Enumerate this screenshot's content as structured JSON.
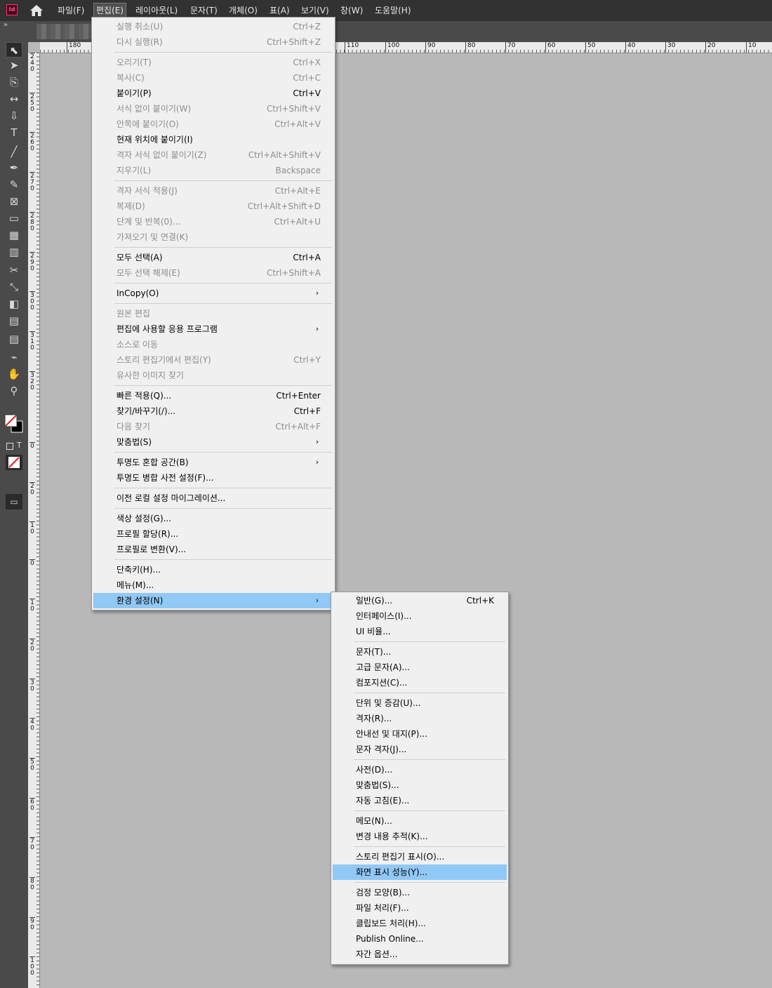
{
  "app": {
    "logo_text": "Id"
  },
  "menubar": {
    "items": [
      "파일(F)",
      "편집(E)",
      "레이아웃(L)",
      "문자(T)",
      "개체(O)",
      "표(A)",
      "보기(V)",
      "창(W)",
      "도움말(H)"
    ],
    "active": "편집(E)"
  },
  "ruler": {
    "h_labels": [
      "180",
      "110",
      "100",
      "90",
      "80",
      "70",
      "60",
      "50",
      "40",
      "30",
      "20",
      "10"
    ],
    "v_labels": [
      "240",
      "250",
      "260",
      "270",
      "280",
      "290",
      "300",
      "310",
      "320",
      "0",
      "20",
      "10",
      "0",
      "10",
      "20",
      "30",
      "40",
      "50",
      "60",
      "70",
      "80",
      "90",
      "100"
    ]
  },
  "toolbar": {
    "tools": [
      "selection-tool",
      "direct-selection-tool",
      "page-tool",
      "gap-tool",
      "content-collector-tool",
      "type-tool",
      "line-tool",
      "pen-tool",
      "pencil-tool",
      "rectangle-frame-tool",
      "rectangle-tool",
      "table-tool",
      "grid-tool",
      "scissors-tool",
      "free-transform-tool",
      "gradient-swatch-tool",
      "gradient-feather-tool",
      "note-tool",
      "eyedropper-tool",
      "hand-tool",
      "zoom-tool"
    ],
    "format_text": "T"
  },
  "edit_menu": {
    "items": [
      {
        "label": "실행 취소(U)",
        "shortcut": "Ctrl+Z",
        "enabled": false
      },
      {
        "label": "다시 실행(R)",
        "shortcut": "Ctrl+Shift+Z",
        "enabled": false
      },
      {
        "label": "오리기(T)",
        "shortcut": "Ctrl+X",
        "enabled": false
      },
      {
        "label": "복사(C)",
        "shortcut": "Ctrl+C",
        "enabled": false
      },
      {
        "label": "붙이기(P)",
        "shortcut": "Ctrl+V",
        "enabled": true
      },
      {
        "label": "서식 없이 붙이기(W)",
        "shortcut": "Ctrl+Shift+V",
        "enabled": false
      },
      {
        "label": "안쪽에 붙이기(O)",
        "shortcut": "Ctrl+Alt+V",
        "enabled": false
      },
      {
        "label": "현재 위치에 붙이기(I)",
        "shortcut": "",
        "enabled": true
      },
      {
        "label": "격자 서식 없이 붙이기(Z)",
        "shortcut": "Ctrl+Alt+Shift+V",
        "enabled": false
      },
      {
        "label": "지우기(L)",
        "shortcut": "Backspace",
        "enabled": false
      },
      {
        "label": "격자 서식 적용(J)",
        "shortcut": "Ctrl+Alt+E",
        "enabled": false
      },
      {
        "label": "복제(D)",
        "shortcut": "Ctrl+Alt+Shift+D",
        "enabled": false
      },
      {
        "label": "단계 및 반복(0)...",
        "shortcut": "Ctrl+Alt+U",
        "enabled": false
      },
      {
        "label": "가져오기 및 연결(K)",
        "shortcut": "",
        "enabled": false
      },
      {
        "label": "모두 선택(A)",
        "shortcut": "Ctrl+A",
        "enabled": true
      },
      {
        "label": "모두 선택 해제(E)",
        "shortcut": "Ctrl+Shift+A",
        "enabled": false
      },
      {
        "label": "InCopy(O)",
        "shortcut": "",
        "enabled": true,
        "submenu": true
      },
      {
        "label": "원본 편집",
        "shortcut": "",
        "enabled": false
      },
      {
        "label": "편집에 사용할 응용 프로그램",
        "shortcut": "",
        "enabled": true,
        "submenu": true
      },
      {
        "label": "소스로 이동",
        "shortcut": "",
        "enabled": false
      },
      {
        "label": "스토리 편집기에서 편집(Y)",
        "shortcut": "Ctrl+Y",
        "enabled": false
      },
      {
        "label": "유사한 이미지 찾기",
        "shortcut": "",
        "enabled": false
      },
      {
        "label": "빠른 적용(Q)...",
        "shortcut": "Ctrl+Enter",
        "enabled": true
      },
      {
        "label": "찾기/바꾸기(/)...",
        "shortcut": "Ctrl+F",
        "enabled": true
      },
      {
        "label": "다음 찾기",
        "shortcut": "Ctrl+Alt+F",
        "enabled": false
      },
      {
        "label": "맞춤법(S)",
        "shortcut": "",
        "enabled": true,
        "submenu": true
      },
      {
        "label": "투명도 혼합 공간(B)",
        "shortcut": "",
        "enabled": true,
        "submenu": true
      },
      {
        "label": "투명도 병합 사전 설정(F)...",
        "shortcut": "",
        "enabled": true
      },
      {
        "label": "이전 로컬 설정 마이그레이션...",
        "shortcut": "",
        "enabled": true
      },
      {
        "label": "색상 설정(G)...",
        "shortcut": "",
        "enabled": true
      },
      {
        "label": "프로필 할당(R)...",
        "shortcut": "",
        "enabled": true
      },
      {
        "label": "프로필로 변환(V)...",
        "shortcut": "",
        "enabled": true
      },
      {
        "label": "단축키(H)...",
        "shortcut": "",
        "enabled": true
      },
      {
        "label": "메뉴(M)...",
        "shortcut": "",
        "enabled": true
      },
      {
        "label": "환경 설정(N)",
        "shortcut": "",
        "enabled": true,
        "submenu": true,
        "highlighted": true
      }
    ]
  },
  "preferences_submenu": {
    "items": [
      {
        "label": "일반(G)...",
        "shortcut": "Ctrl+K"
      },
      {
        "label": "인터페이스(I)...",
        "shortcut": ""
      },
      {
        "label": "UI 비율...",
        "shortcut": ""
      },
      {
        "label": "문자(T)...",
        "shortcut": ""
      },
      {
        "label": "고급 문자(A)...",
        "shortcut": ""
      },
      {
        "label": "컴포지션(C)...",
        "shortcut": ""
      },
      {
        "label": "단위 및 증감(U)...",
        "shortcut": ""
      },
      {
        "label": "격자(R)...",
        "shortcut": ""
      },
      {
        "label": "안내선 및 대지(P)...",
        "shortcut": ""
      },
      {
        "label": "문자 격자(J)...",
        "shortcut": ""
      },
      {
        "label": "사전(D)...",
        "shortcut": ""
      },
      {
        "label": "맞춤법(S)...",
        "shortcut": ""
      },
      {
        "label": "자동 고침(E)...",
        "shortcut": ""
      },
      {
        "label": "메모(N)...",
        "shortcut": ""
      },
      {
        "label": "변경 내용 추적(K)...",
        "shortcut": ""
      },
      {
        "label": "스토리 편집기 표시(O)...",
        "shortcut": ""
      },
      {
        "label": "화면 표시 성능(Y)...",
        "shortcut": "",
        "highlighted": true
      },
      {
        "label": "검정 모양(B)...",
        "shortcut": ""
      },
      {
        "label": "파일 처리(F)...",
        "shortcut": ""
      },
      {
        "label": "클립보드 처리(H)...",
        "shortcut": ""
      },
      {
        "label": "Publish Online...",
        "shortcut": ""
      },
      {
        "label": "자간 옵션...",
        "shortcut": ""
      }
    ]
  },
  "colors": {
    "menubar_bg": "#323232",
    "toolbar_bg": "#4a4a4a",
    "canvas_bg": "#b8b8b8",
    "menu_bg": "#f0f0f0",
    "highlight": "#90c8f6",
    "logo_accent": "#ff3366"
  }
}
